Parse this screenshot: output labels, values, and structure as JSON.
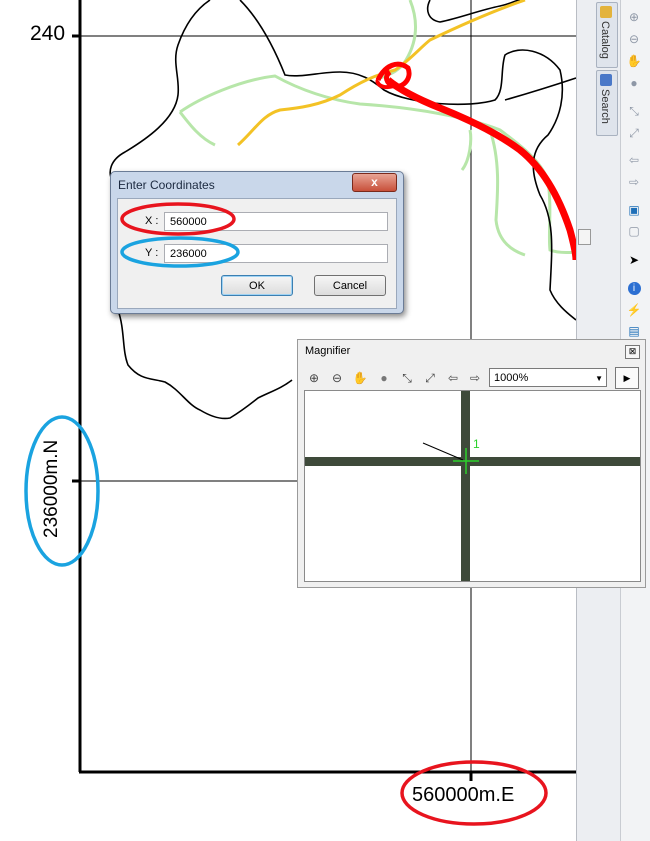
{
  "map": {
    "top_tick_label": "240",
    "y_axis_label": "236000m.N",
    "x_axis_label": "560000m.E",
    "highlight_colors": {
      "x": "#e8141e",
      "y": "#1aa3e0"
    },
    "road_colors": {
      "yellow": "#f3c225",
      "red": "#ff0000",
      "green": "#b7e6a9"
    }
  },
  "right_panel": {
    "tabs": [
      {
        "label": "Catalog",
        "icon": "catalog-icon"
      },
      {
        "label": "Search",
        "icon": "search-window-icon"
      }
    ],
    "tools": [
      "zoom-in-icon",
      "zoom-out-icon",
      "pan-hand-icon",
      "full-extent-globe-icon",
      "fixed-zoom-in-icon",
      "fixed-zoom-out-icon",
      "back-arrow-icon",
      "forward-arrow-icon",
      "select-features-icon",
      "clear-selection-icon",
      "select-elements-arrow-icon",
      "identify-icon",
      "hyperlink-icon",
      "html-popup-icon"
    ]
  },
  "dialog": {
    "title": "Enter Coordinates",
    "close_glyph": "x",
    "x_label": "X :",
    "x_value": "560000",
    "y_label": "Y :",
    "y_value": "236000",
    "ok_label": "OK",
    "cancel_label": "Cancel"
  },
  "magnifier": {
    "title": "Magnifier",
    "close_glyph": "⊠",
    "zoom_value": "1000%",
    "point_label": "1",
    "toolbar_icons": [
      "zoom-in-icon",
      "zoom-out-icon",
      "pan-hand-icon",
      "full-extent-globe-icon",
      "fixed-zoom-in-icon",
      "fixed-zoom-out-icon",
      "back-arrow-icon",
      "forward-arrow-icon"
    ]
  }
}
